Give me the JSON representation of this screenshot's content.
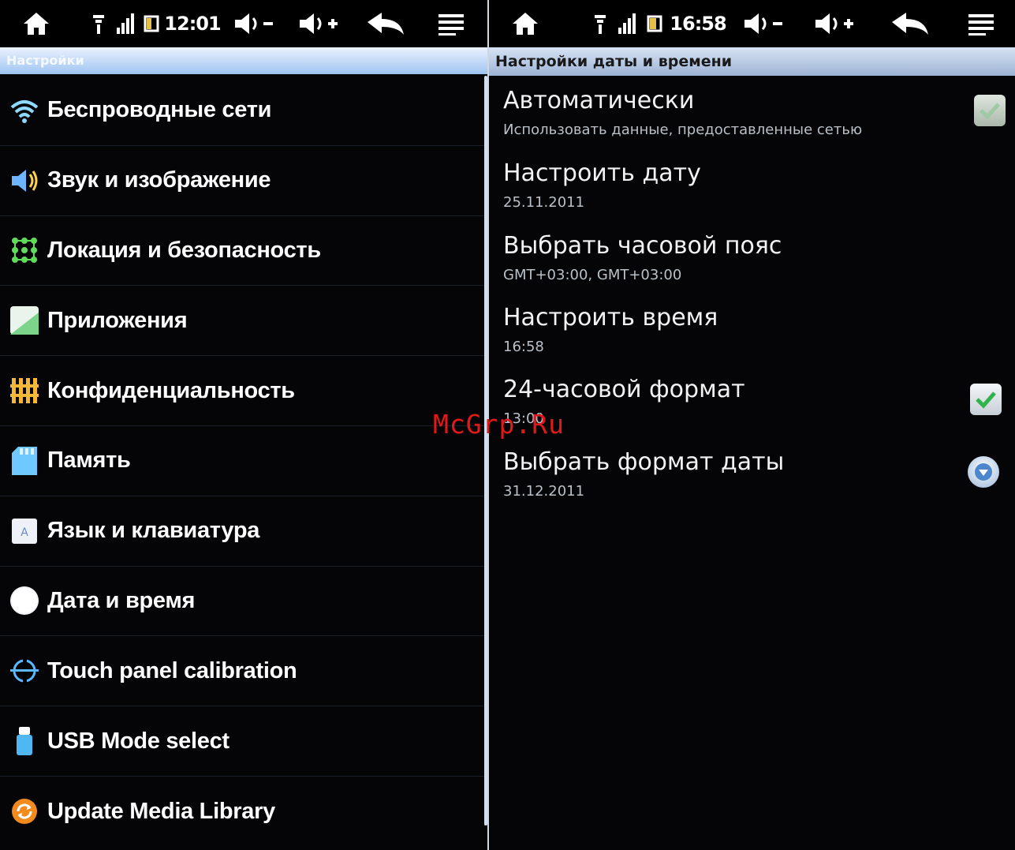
{
  "left_panel": {
    "status_bar": {
      "time": "12:01"
    },
    "title": "Настройки",
    "menu_items": [
      {
        "label": "Беспроводные сети",
        "icon": "wifi-icon"
      },
      {
        "label": "Звук и изображение",
        "icon": "speaker-icon"
      },
      {
        "label": "Локация и безопасность",
        "icon": "grid-lock-icon"
      },
      {
        "label": "Приложения",
        "icon": "applications-icon"
      },
      {
        "label": "Конфиденциальность",
        "icon": "privacy-icon"
      },
      {
        "label": "Память",
        "icon": "sd-card-icon"
      },
      {
        "label": "Язык и клавиатура",
        "icon": "keyboard-icon"
      },
      {
        "label": "Дата и время",
        "icon": "clock-icon"
      },
      {
        "label": "Touch panel calibration",
        "icon": "calibration-icon"
      },
      {
        "label": "USB Mode select",
        "icon": "usb-icon"
      },
      {
        "label": "Update Media Library",
        "icon": "refresh-icon"
      }
    ]
  },
  "right_panel": {
    "status_bar": {
      "time": "16:58"
    },
    "title": "Настройки даты и времени",
    "items": [
      {
        "title": "Автоматически",
        "subtitle": "Использовать данные, предоставленные сетью",
        "control": "checkbox",
        "checked": true
      },
      {
        "title": "Настроить дату",
        "subtitle": "25.11.2011",
        "control": "none"
      },
      {
        "title": "Выбрать часовой пояс",
        "subtitle": "GMT+03:00, GMT+03:00",
        "control": "none"
      },
      {
        "title": "Настроить время",
        "subtitle": "16:58",
        "control": "none"
      },
      {
        "title": "24-часовой формат",
        "subtitle": "13:00",
        "control": "checkbox",
        "checked": true
      },
      {
        "title": "Выбрать формат даты",
        "subtitle": "31.12.2011",
        "control": "dropdown"
      }
    ]
  },
  "watermark": "McGrp.Ru",
  "colors": {
    "title_bar": "#b7c9e6",
    "check_green": "#2fb34a",
    "watermark": "#e01a1a"
  }
}
